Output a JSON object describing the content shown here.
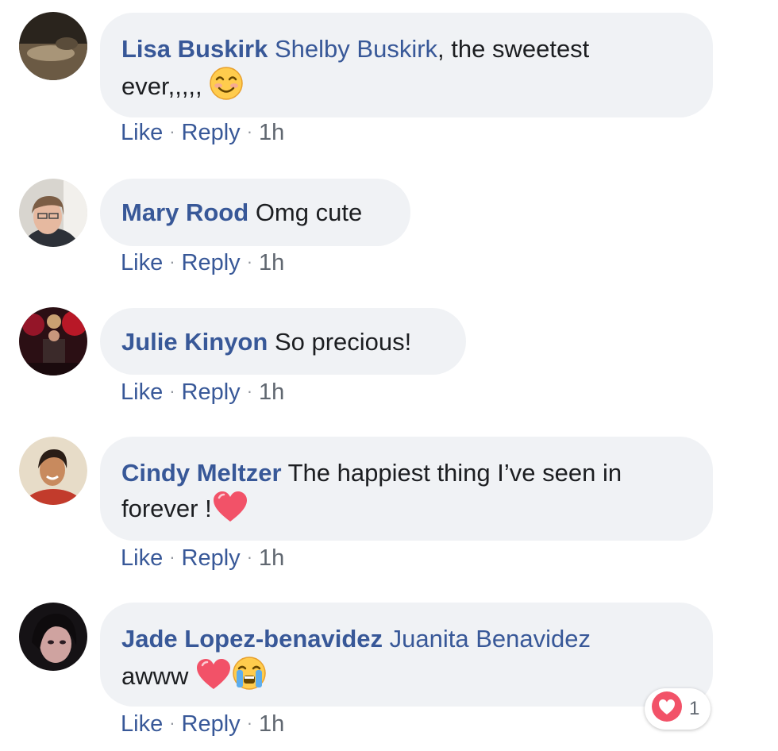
{
  "comments": [
    {
      "author": "Lisa Buskirk",
      "mention": "Shelby Buskirk",
      "text_line1": ", the sweetest",
      "text_line2": "ever,,,,,",
      "emoji": "smiling-face-emoji",
      "like": "Like",
      "reply": "Reply",
      "time": "1h"
    },
    {
      "author": "Mary Rood",
      "text": "Omg cute",
      "like": "Like",
      "reply": "Reply",
      "time": "1h"
    },
    {
      "author": "Julie Kinyon",
      "text": "So precious!",
      "like": "Like",
      "reply": "Reply",
      "time": "1h"
    },
    {
      "author": "Cindy Meltzer",
      "text_line1": "The happiest thing I’ve seen in",
      "text_line2": "forever !",
      "emoji": "heart-emoji",
      "like": "Like",
      "reply": "Reply",
      "time": "1h"
    },
    {
      "author": "Jade Lopez-benavidez",
      "mention": "Juanita Benavidez",
      "text_line2": "awww",
      "emoji": "heart-emoji",
      "emoji2": "crying-face-emoji",
      "like": "Like",
      "reply": "Reply",
      "time": "1h",
      "reaction_icon": "love-reaction-icon",
      "reaction_count": "1"
    }
  ],
  "colors": {
    "name": "#385898",
    "bubble": "#f0f2f5",
    "heart": "#f25268"
  }
}
